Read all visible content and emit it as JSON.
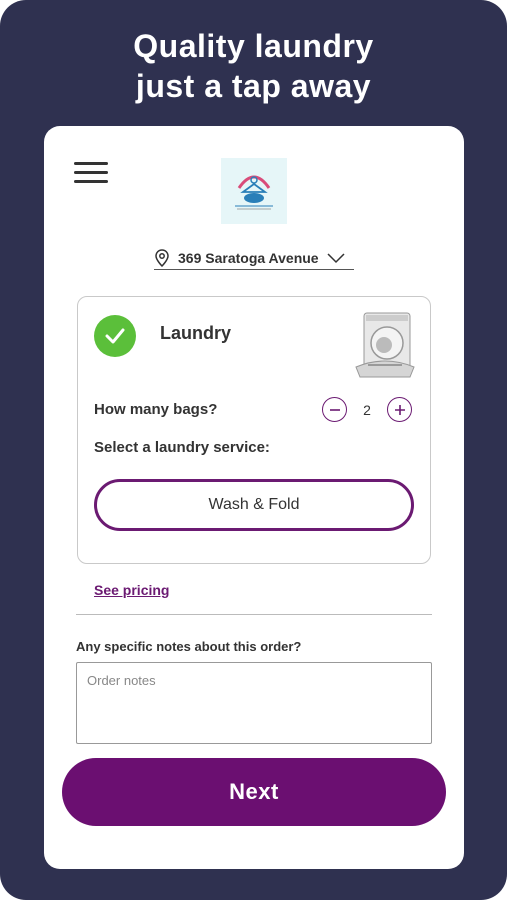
{
  "banner": {
    "headline_line1": "Quality laundry",
    "headline_line2": "just a tap away"
  },
  "header": {
    "menu_icon": "hamburger-menu-icon",
    "logo_text_top": "LADY CLEANERS LAUNDRY",
    "logo_text_bottom": "LEAVE YOUR LAUNDRY TO US"
  },
  "address": {
    "icon": "location-pin-icon",
    "value": "369 Saratoga Avenue",
    "dropdown_icon": "chevron-down-icon"
  },
  "service_card": {
    "selected_icon": "check-icon",
    "title": "Laundry",
    "bags_label": "How many bags?",
    "bags_count": "2",
    "decrement_icon": "minus-circle-icon",
    "increment_icon": "plus-circle-icon",
    "service_label": "Select a laundry service:",
    "service_option": "Wash & Fold"
  },
  "pricing_link": "See pricing",
  "notes": {
    "label": "Any specific notes about this order?",
    "placeholder": "Order notes",
    "value": ""
  },
  "next_label": "Next",
  "colors": {
    "frame_bg": "#2f3150",
    "accent": "#6b0f71",
    "check_green": "#5bbf3a"
  }
}
